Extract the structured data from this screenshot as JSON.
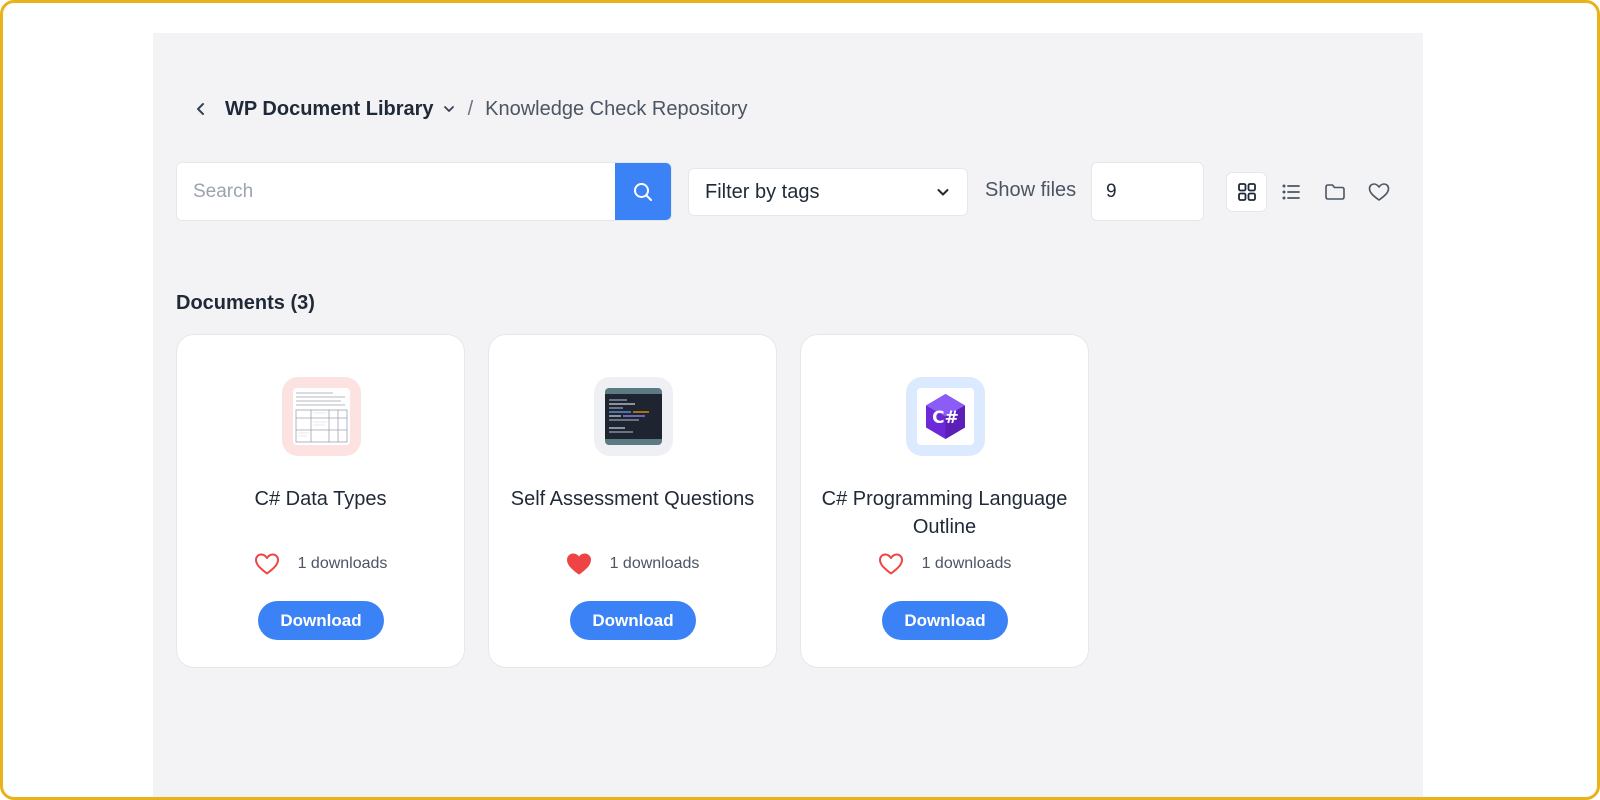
{
  "breadcrumb": {
    "root": "WP Document Library",
    "separator": "/",
    "current": "Knowledge Check Repository"
  },
  "toolbar": {
    "search_placeholder": "Search",
    "filter_label": "Filter by tags",
    "show_files_label": "Show files",
    "show_files_value": "9"
  },
  "section": {
    "title": "Documents (3)"
  },
  "documents": [
    {
      "title": "C# Data Types",
      "downloads": "1 downloads",
      "favorited": false,
      "button": "Download"
    },
    {
      "title": "Self Assessment Questions",
      "downloads": "1 downloads",
      "favorited": true,
      "button": "Download"
    },
    {
      "title": "C# Programming Language Outline",
      "downloads": "1 downloads",
      "favorited": false,
      "button": "Download"
    }
  ],
  "colors": {
    "accent": "#3b82f6",
    "heart": "#ef4444",
    "frame": "#e8b21a",
    "panel": "#f3f3f5"
  }
}
